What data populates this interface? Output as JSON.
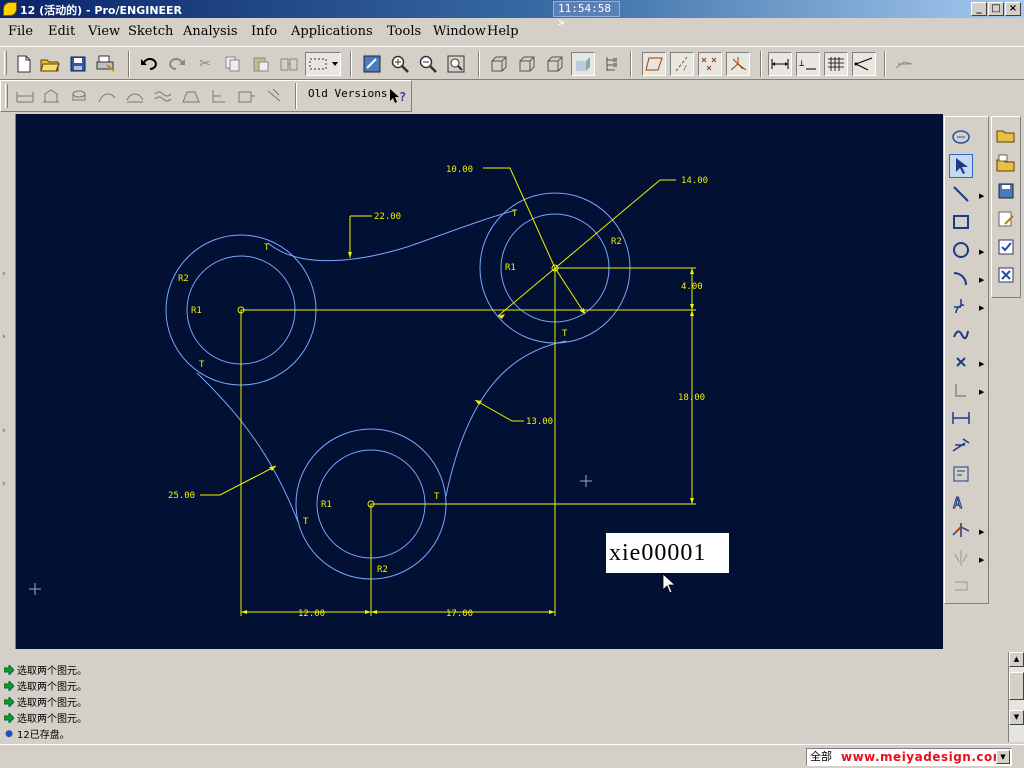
{
  "window": {
    "title": "12 (活动的) - Pro/ENGINEER",
    "clock": "11:54:58",
    "minimize": "_",
    "maximize": "□",
    "close": "×"
  },
  "menu": [
    "File",
    "Edit",
    "View",
    "Sketch",
    "Analysis",
    "Info",
    "Applications",
    "Tools",
    "Window",
    "Help"
  ],
  "toolbar2": {
    "old_versions_label": "Old Versions"
  },
  "sketch": {
    "dimensions": {
      "d_10": "10.00",
      "d_14": "14.00",
      "d_22": "22.00",
      "d_4": "4.00",
      "d_18": "18.00",
      "d_13": "13.00",
      "d_25": "25.00",
      "d_12": "12.00",
      "d_17": "17.00"
    },
    "constraints": {
      "r1": "R1",
      "r2": "R2",
      "t": "T"
    },
    "overlay_label": "xie00001",
    "colors": {
      "background": "#011033",
      "geometry": "#7aa6ff",
      "dimension": "#f0f000"
    }
  },
  "messages": [
    {
      "icon": "green-arrow-icon",
      "text": "选取两个图元。"
    },
    {
      "icon": "green-arrow-icon",
      "text": "选取两个图元。"
    },
    {
      "icon": "green-arrow-icon",
      "text": "选取两个图元。"
    },
    {
      "icon": "green-arrow-icon",
      "text": "选取两个图元。"
    },
    {
      "icon": "bullet-icon",
      "text": "12已存盘。"
    }
  ],
  "status": {
    "filter_value": "全部",
    "watermark": "www.meiyadesign.com"
  }
}
